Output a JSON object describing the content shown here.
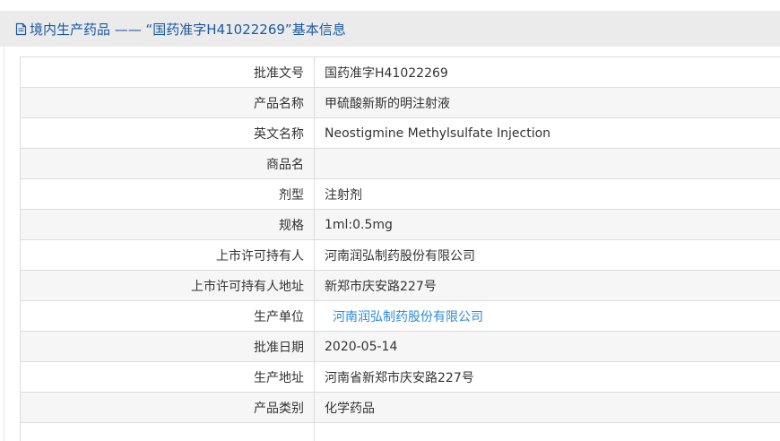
{
  "header": {
    "icon": "document-icon",
    "title": "境内生产药品 —— “国药准字H41022269”基本信息"
  },
  "colors": {
    "header_bg": "#ebebeb",
    "title": "#1a5aa3",
    "link": "#2b8bd8",
    "stripe": "#f6f6f6"
  },
  "fields": [
    {
      "label": "批准文号",
      "value": "国药准字H41022269",
      "link": false
    },
    {
      "label": "产品名称",
      "value": "甲硫酸新斯的明注射液",
      "link": false
    },
    {
      "label": "英文名称",
      "value": "Neostigmine Methylsulfate Injection",
      "link": false
    },
    {
      "label": "商品名",
      "value": "",
      "link": false
    },
    {
      "label": "剂型",
      "value": "注射剂",
      "link": false
    },
    {
      "label": "规格",
      "value": "1ml:0.5mg",
      "link": false
    },
    {
      "label": "上市许可持有人",
      "value": "河南润弘制药股份有限公司",
      "link": false
    },
    {
      "label": "上市许可持有人地址",
      "value": "新郑市庆安路227号",
      "link": false
    },
    {
      "label": "生产单位",
      "value": "河南润弘制药股份有限公司",
      "link": true
    },
    {
      "label": "批准日期",
      "value": "2020-05-14",
      "link": false
    },
    {
      "label": "生产地址",
      "value": "河南省新郑市庆安路227号",
      "link": false
    },
    {
      "label": "产品类别",
      "value": "化学药品",
      "link": false
    }
  ]
}
